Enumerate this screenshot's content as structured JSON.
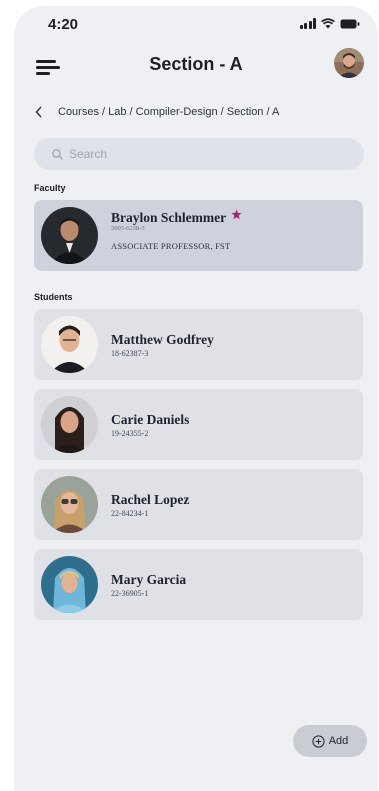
{
  "status_bar": {
    "time": "4:20"
  },
  "header": {
    "title": "Section - A"
  },
  "breadcrumb": {
    "path": "Courses / Lab / Compiler-Design / Section / A"
  },
  "search": {
    "placeholder": "Search"
  },
  "faculty": {
    "label": "Faculty",
    "member": {
      "name": "Braylon Schlemmer",
      "id": "2005-6238-3",
      "role": "ASSOCIATE PROFESSOR, FST"
    }
  },
  "students": {
    "label": "Students",
    "items": [
      {
        "name": "Matthew Godfrey",
        "id": "18-62387-3"
      },
      {
        "name": "Carie Daniels",
        "id": "19-24355-2"
      },
      {
        "name": "Rachel Lopez",
        "id": "22-84234-1"
      },
      {
        "name": "Mary Garcia",
        "id": "22-36905-1"
      }
    ]
  },
  "add_button": {
    "label": "Add",
    "icon": "plus-circle-icon"
  },
  "colors": {
    "background": "#eef0f4",
    "card": "#dfe1e6",
    "faculty_card": "#cdd2dc",
    "badge": "#c2265e"
  }
}
